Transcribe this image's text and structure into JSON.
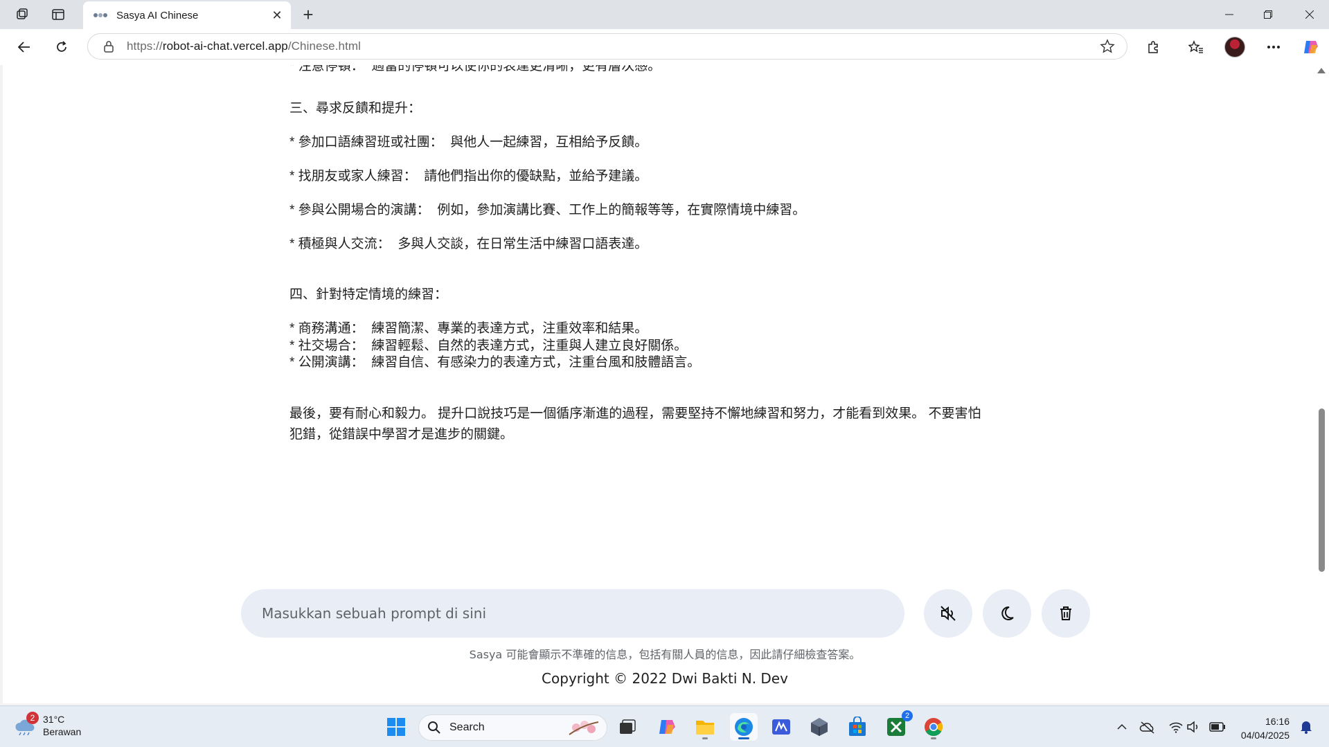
{
  "browser": {
    "tab_title": "Sasya AI Chinese",
    "url_protocol": "https://",
    "url_host": "robot-ai-chat.vercel.app",
    "url_path": "/Chinese.html"
  },
  "chat": {
    "lines": [
      "* 注意停頓：  適當的停頓可以使你的表達更清晰，更有層次感。",
      "三、尋求反饋和提升：",
      "* 參加口語練習班或社團：  與他人一起練習，互相給予反饋。",
      "* 找朋友或家人練習：  請他們指出你的優缺點，並給予建議。",
      "* 參與公開場合的演講：  例如，參加演講比賽、工作上的簡報等等，在實際情境中練習。",
      "* 積極與人交流：  多與人交談，在日常生活中練習口語表達。",
      "四、針對特定情境的練習：",
      "* 商務溝通：  練習簡潔、專業的表達方式，注重效率和結果。",
      "* 社交場合：  練習輕鬆、自然的表達方式，注重與人建立良好關係。",
      "* 公開演講：  練習自信、有感染力的表達方式，注重台風和肢體語言。",
      "最後，要有耐心和毅力。 提升口說技巧是一個循序漸進的過程，需要堅持不懈地練習和努力，才能看到效果。 不要害怕犯錯，從錯誤中學習才是進步的關鍵。"
    ]
  },
  "composer": {
    "placeholder": "Masukkan sebuah prompt di sini"
  },
  "footer": {
    "disclaimer": "Sasya 可能會顯示不準確的信息，包括有關人員的信息，因此請仔細檢查答案。",
    "copyright": "Copyright © 2022 Dwi Bakti N. Dev"
  },
  "taskbar": {
    "weather_badge": "2",
    "temperature": "31°C",
    "condition": "Berawan",
    "search_label": "Search",
    "store_badge": "2",
    "time": "16:16",
    "date": "04/04/2025"
  }
}
